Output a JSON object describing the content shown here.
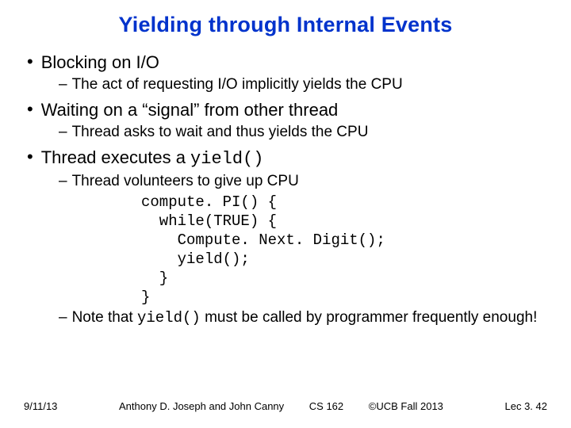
{
  "title": "Yielding through Internal Events",
  "items": [
    {
      "text": "Blocking on I/O",
      "subs": [
        {
          "text": "The act of requesting I/O implicitly yields the CPU"
        }
      ]
    },
    {
      "text": "Waiting on a “signal” from other thread",
      "subs": [
        {
          "text": "Thread asks to wait and thus yields the CPU"
        }
      ]
    },
    {
      "text_prefix": "Thread executes a ",
      "text_code": "yield()",
      "subs": [
        {
          "text": "Thread volunteers to give up CPU"
        },
        {
          "code": "compute. PI() {\n  while(TRUE) {\n    Compute. Next. Digit();\n    yield();\n  }\n}"
        },
        {
          "text_prefix": "Note that ",
          "text_code": "yield()",
          "text_suffix": " must be called by programmer frequently enough!"
        }
      ]
    }
  ],
  "footer": {
    "date": "9/11/13",
    "authors": "Anthony D. Joseph and John Canny",
    "course": "CS 162",
    "copyright": "©UCB Fall 2013",
    "lec": "Lec 3. 42"
  }
}
